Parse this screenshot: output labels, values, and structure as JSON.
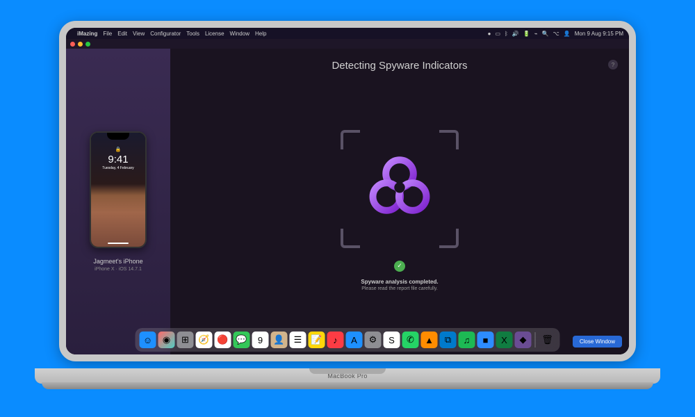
{
  "menubar": {
    "app": "iMazing",
    "items": [
      "File",
      "Edit",
      "View",
      "Configurator",
      "Tools",
      "License",
      "Window",
      "Help"
    ],
    "datetime": "Mon 9 Aug 9:15 PM"
  },
  "sidebar": {
    "phone": {
      "time": "9:41",
      "date": "Tuesday, 4 February"
    },
    "device_name": "Jagmeet's iPhone",
    "device_info": "iPhone X · iOS 14.7.1"
  },
  "main": {
    "title": "Detecting Spyware Indicators",
    "help": "?",
    "status_line1": "Spyware analysis completed.",
    "status_line2": "Please read the report file carefully.",
    "close_button": "Close Window"
  },
  "laptop_label": "MacBook Pro",
  "colors": {
    "page_bg": "#0a8cff",
    "accent": "#a855f7",
    "success": "#4caf50",
    "button": "#2869d6"
  },
  "icons": {
    "biohazard": "biohazard-icon",
    "check": "check-icon"
  },
  "dock_icons": [
    {
      "name": "finder",
      "bg": "#1e90ff",
      "glyph": "☺"
    },
    {
      "name": "siri",
      "bg": "linear-gradient(135deg,#ff6b6b,#4ecdc4)",
      "glyph": "◉"
    },
    {
      "name": "launchpad",
      "bg": "#8e8e93",
      "glyph": "⊞"
    },
    {
      "name": "safari",
      "bg": "#fff",
      "glyph": "🧭"
    },
    {
      "name": "opera",
      "bg": "#fff",
      "glyph": "🔴"
    },
    {
      "name": "messages",
      "bg": "#34c759",
      "glyph": "💬"
    },
    {
      "name": "calendar",
      "bg": "#fff",
      "glyph": "9"
    },
    {
      "name": "contacts",
      "bg": "#d2b48c",
      "glyph": "👤"
    },
    {
      "name": "reminders",
      "bg": "#fff",
      "glyph": "☰"
    },
    {
      "name": "notes",
      "bg": "#ffd60a",
      "glyph": "📝"
    },
    {
      "name": "music",
      "bg": "#fc3c44",
      "glyph": "♪"
    },
    {
      "name": "appstore",
      "bg": "#1e90ff",
      "glyph": "A"
    },
    {
      "name": "settings",
      "bg": "#8e8e93",
      "glyph": "⚙"
    },
    {
      "name": "skype",
      "bg": "#fff",
      "glyph": "S"
    },
    {
      "name": "whatsapp",
      "bg": "#25d366",
      "glyph": "✆"
    },
    {
      "name": "vlc",
      "bg": "#ff8c00",
      "glyph": "▲"
    },
    {
      "name": "vscode",
      "bg": "#007acc",
      "glyph": "⧉"
    },
    {
      "name": "spotify",
      "bg": "#1db954",
      "glyph": "♫"
    },
    {
      "name": "zoom",
      "bg": "#2d8cff",
      "glyph": "■"
    },
    {
      "name": "excel",
      "bg": "#107c41",
      "glyph": "X"
    },
    {
      "name": "imazing",
      "bg": "#6a4c93",
      "glyph": "◆"
    }
  ],
  "trash_icon": {
    "name": "trash",
    "bg": "transparent",
    "glyph": "🗑"
  }
}
